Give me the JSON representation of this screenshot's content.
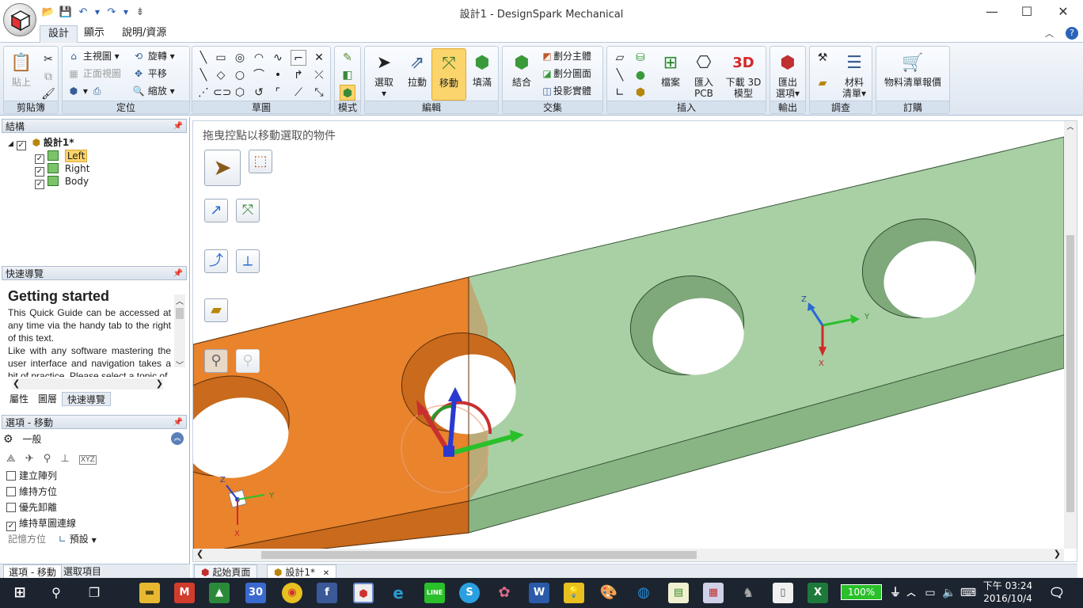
{
  "window": {
    "title": "設計1 - DesignSpark Mechanical"
  },
  "ribbon": {
    "tabs": [
      "設計",
      "顯示",
      "說明/資源"
    ],
    "groups": {
      "clipboard": {
        "label": "剪貼簿",
        "paste": "貼上"
      },
      "orient": {
        "label": "定位",
        "home": "主視圖",
        "plan": "正面視圖",
        "spin": "旋轉",
        "pan": "平移",
        "zoom": "縮放"
      },
      "sketch": {
        "label": "草圖"
      },
      "mode": {
        "label": "模式"
      },
      "edit": {
        "label": "編輯",
        "select": "選取",
        "pull": "拉動",
        "move": "移動",
        "fill": "填滿"
      },
      "intersect": {
        "label": "交集",
        "combine": "結合",
        "split_body": "劃分主體",
        "split_face": "劃分圖面",
        "project": "投影實體"
      },
      "insert": {
        "label": "插入",
        "file": "檔案",
        "import_pcb_1": "匯入",
        "import_pcb_2": "PCB",
        "download_3d_1": "下載 3D",
        "download_3d_2": "模型"
      },
      "output": {
        "label": "輸出",
        "export_1": "匯出",
        "export_2": "選項"
      },
      "investigate": {
        "label": "調查",
        "bom_1": "材料",
        "bom_2": "清單"
      },
      "order": {
        "label": "訂購",
        "quote": "物料清單報價"
      }
    }
  },
  "structure": {
    "title": "結構",
    "root": "設計1*",
    "items": [
      {
        "label": "Left",
        "selected": true
      },
      {
        "label": "Right",
        "selected": false
      },
      {
        "label": "Body",
        "selected": false
      }
    ]
  },
  "quickguide": {
    "title": "快速導覽",
    "heading": "Getting started",
    "p1": "This Quick Guide can be accessed at any time via the handy tab to the right of this text.",
    "p2": "Like with any software mastering the user interface and navigation takes a bit of practice. Please select a topic of",
    "tabs": [
      "屬性",
      "圖層",
      "快速導覽"
    ]
  },
  "options": {
    "title": "選項 - 移動",
    "section": "一般",
    "checks": [
      {
        "label": "建立陣列",
        "checked": false
      },
      {
        "label": "維持方位",
        "checked": false
      },
      {
        "label": "優先卸離",
        "checked": false
      },
      {
        "label": "維持草圖連線",
        "checked": true
      }
    ],
    "memory_label": "記憶方位",
    "memory_value": "預設",
    "bottom_tabs": [
      "選項 - 移動",
      "選取項目"
    ]
  },
  "viewport": {
    "hint": "拖曳控點以移動選取的物件",
    "axis_x": "X",
    "axis_y": "Y",
    "axis_z": "Z"
  },
  "doc_tabs": [
    "起始頁面",
    "設計1*"
  ],
  "taskbar": {
    "battery": "100%",
    "time": "下午 03:24",
    "date": "2016/10/4",
    "calendar_day": "30"
  },
  "colors": {
    "orange_body": "#e87f2a",
    "green_body": "#a8cfa4",
    "ribbon_active": "#fbd46c"
  }
}
